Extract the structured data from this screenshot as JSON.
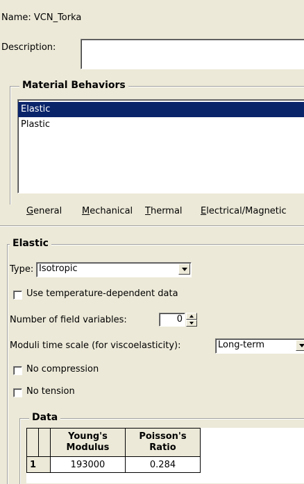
{
  "name_label": "Name:",
  "name_value": "VCN_Torka",
  "description_label": "Description:",
  "description_value": "",
  "material_behaviors": {
    "title": "Material Behaviors",
    "items": [
      {
        "label": "Elastic",
        "selected": true
      },
      {
        "label": "Plastic",
        "selected": false
      }
    ]
  },
  "menu": [
    {
      "mnemonic": "G",
      "rest": "eneral"
    },
    {
      "mnemonic": "M",
      "rest": "echanical"
    },
    {
      "mnemonic": "T",
      "rest": "hermal"
    },
    {
      "mnemonic": "E",
      "rest": "lectrical/Magnetic"
    }
  ],
  "elastic": {
    "title": "Elastic",
    "type_label": "Type:",
    "type_value": "Isotropic",
    "temp_dep_label": "Use temperature-dependent data",
    "temp_dep_checked": false,
    "field_vars_label": "Number of field variables:",
    "field_vars_value": "0",
    "moduli_label": "Moduli time scale (for viscoelasticity):",
    "moduli_value": "Long-term",
    "no_compression_label": "No compression",
    "no_compression_checked": false,
    "no_tension_label": "No tension",
    "no_tension_checked": false
  },
  "data_table": {
    "title": "Data",
    "columns": [
      {
        "line1": "Young's",
        "line2": "Modulus"
      },
      {
        "line1": "Poisson's",
        "line2": "Ratio"
      }
    ],
    "rows": [
      {
        "index": "1",
        "cells": [
          "193000",
          "0.284"
        ]
      }
    ]
  },
  "colors": {
    "window_bg": "#ece9d8",
    "selection_bg": "#0a246a",
    "selection_fg": "#ffffff"
  }
}
